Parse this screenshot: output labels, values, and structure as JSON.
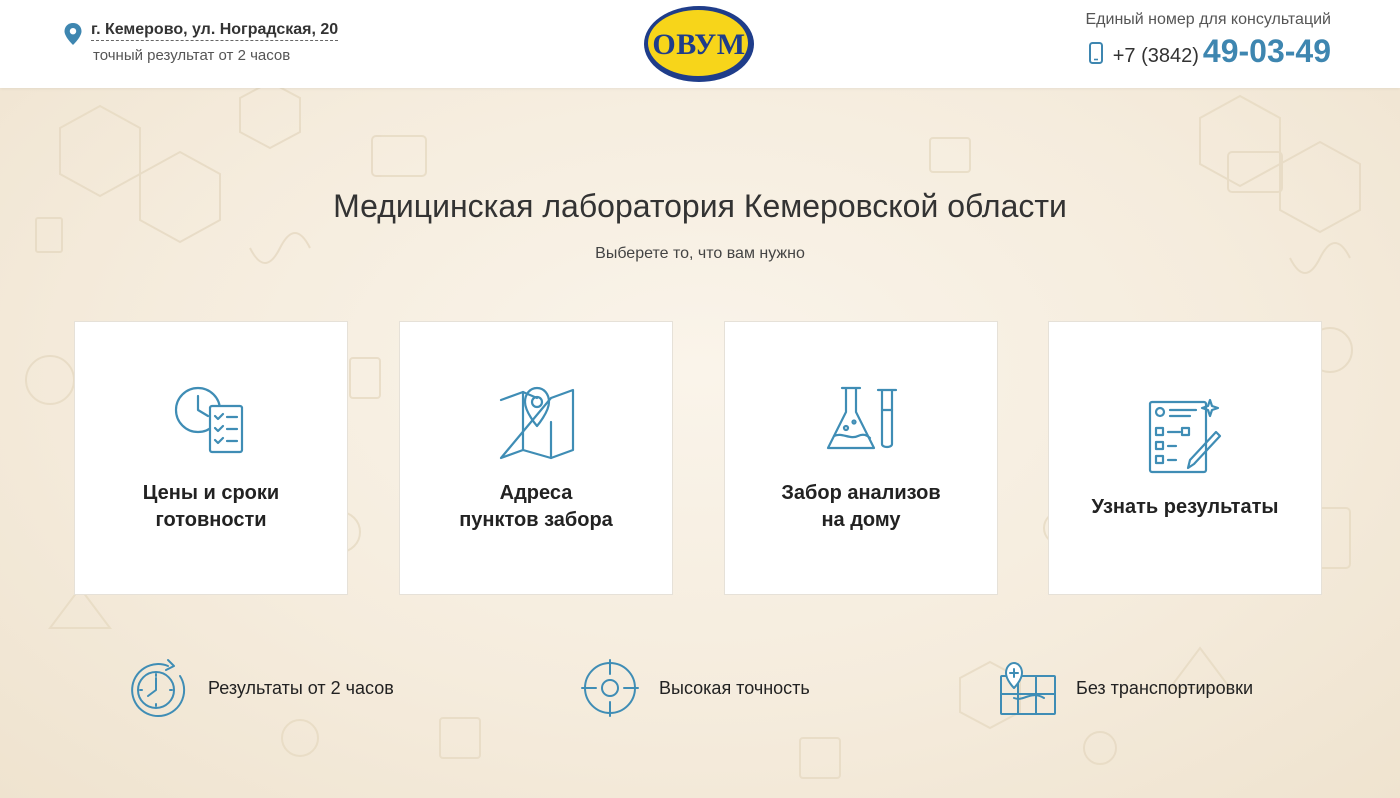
{
  "header": {
    "address": "г. Кемерово, ул. Ноградская, 20",
    "address_note": "точный результат от 2 часов",
    "logo_text": "ОВУМ",
    "contact_label": "Единый номер для консультаций",
    "phone_prefix": "+7 (3842)",
    "phone_number": "49-03-49",
    "icons": [
      "location-pin-icon",
      "mobile-phone-icon"
    ]
  },
  "hero": {
    "title": "Медицинская лаборатория Кемеровской области",
    "subtitle": "Выберете то, что вам нужно"
  },
  "cards": [
    {
      "label": "Цены и сроки\nготовности",
      "icon": "clock-checklist-icon"
    },
    {
      "label": "Адреса\nпунктов забора",
      "icon": "map-pin-icon"
    },
    {
      "label": "Забор анализов\nна дому",
      "icon": "lab-flask-icon"
    },
    {
      "label": "Узнать результаты",
      "icon": "results-form-icon"
    }
  ],
  "features": [
    {
      "label": "Результаты от 2 часов",
      "icon": "stopwatch-icon"
    },
    {
      "label": "Высокая точность",
      "icon": "crosshair-icon"
    },
    {
      "label": "Без транспортировки",
      "icon": "map-route-icon"
    }
  ],
  "colors": {
    "accent": "#3e86b0",
    "icon_stroke": "#3f8db5",
    "logo_yellow": "#f7d51a",
    "logo_blue": "#1f3d8a",
    "background": "#f4ebdc"
  }
}
